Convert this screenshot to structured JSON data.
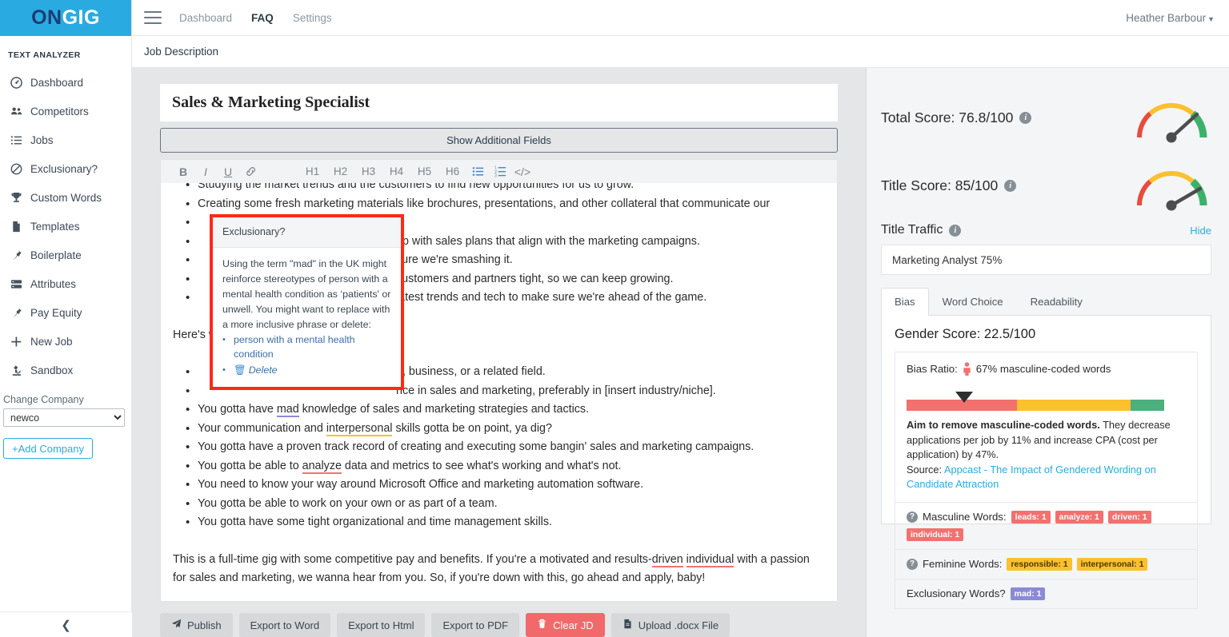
{
  "brand": {
    "logo_on": "ON",
    "logo_gig": "GIG",
    "accent": "#29ABE2"
  },
  "sidebar": {
    "section_title": "TEXT ANALYZER",
    "items": [
      {
        "label": "Dashboard",
        "icon": "dashboard-icon"
      },
      {
        "label": "Competitors",
        "icon": "people-icon"
      },
      {
        "label": "Jobs",
        "icon": "list-icon"
      },
      {
        "label": "Exclusionary?",
        "icon": "ban-icon"
      },
      {
        "label": "Custom Words",
        "icon": "trophy-icon"
      },
      {
        "label": "Templates",
        "icon": "file-icon"
      },
      {
        "label": "Boilerplate",
        "icon": "pin-icon"
      },
      {
        "label": "Attributes",
        "icon": "server-icon"
      },
      {
        "label": "Pay Equity",
        "icon": "pin-icon"
      },
      {
        "label": "New Job",
        "icon": "plus-icon"
      },
      {
        "label": "Sandbox",
        "icon": "microscope-icon"
      }
    ],
    "change_company_label": "Change Company",
    "company_selected": "newco",
    "company_options": [
      "newco"
    ],
    "add_company_label": "+Add Company",
    "collapse_icon": "chevron-left-icon"
  },
  "topnav": {
    "links": [
      {
        "label": "Dashboard",
        "active": false
      },
      {
        "label": "FAQ",
        "active": true
      },
      {
        "label": "Settings",
        "active": false
      }
    ],
    "user": "Heather Barbour"
  },
  "subheader": {
    "breadcrumb": "Job Description"
  },
  "editor": {
    "job_title": "Sales & Marketing Specialist",
    "show_additional_fields": "Show Additional Fields",
    "toolbar": {
      "bold": "B",
      "italic": "I",
      "underline": "U",
      "link": "link-icon",
      "headings": [
        "H1",
        "H2",
        "H3",
        "H4",
        "H5",
        "H6"
      ],
      "bullet_list": "bullet-list-icon",
      "numbered_list": "numbered-list-icon",
      "code": "</>"
    },
    "content": {
      "clipped_top_line": "Studying the market trends and the customers to find new opportunities for us to grow.",
      "bullets_top": [
        "Creating some fresh marketing materials like brochures, presentations, and other collateral that communicate our",
        "up with sales plans that align with the marketing campaigns.",
        "sure we're smashing it.",
        "customers and partners tight, so we can keep growing.",
        "latest trends and tech to make sure we're ahead of the game."
      ],
      "heres_line": "Here's what you gotta have to be eligible:",
      "bullets_hidden_tail": [
        "g, business, or a related field.",
        "nce in sales and marketing, preferably in [insert industry/niche]."
      ],
      "bullets_bottom": [
        {
          "pre": "You gotta have ",
          "mark": "mad",
          "mark_style": "purple",
          "post": " knowledge of sales and marketing strategies and tactics."
        },
        {
          "pre": "Your communication and ",
          "mark": "interpersonal",
          "mark_style": "yellow",
          "post": " skills gotta be on point, ya dig?"
        },
        {
          "pre": "You gotta have a proven track record of creating and executing some bangin' sales and marketing campaigns.",
          "mark": "",
          "mark_style": "",
          "post": ""
        },
        {
          "pre": "You gotta be able to ",
          "mark": "analyze",
          "mark_style": "red",
          "post": " data and metrics to see what's working and what's not."
        },
        {
          "pre": "You need to know your way around Microsoft Office and marketing automation software.",
          "mark": "",
          "mark_style": "",
          "post": ""
        },
        {
          "pre": "You gotta be able to work on your own or as part of a team.",
          "mark": "",
          "mark_style": "",
          "post": ""
        },
        {
          "pre": "You gotta have some tight organizational and time management skills.",
          "mark": "",
          "mark_style": "",
          "post": ""
        }
      ],
      "closing_pre": "This is a full-time gig with some competitive pay and benefits. If you're a motivated and results-",
      "closing_mark1": "driven",
      "closing_mid": " ",
      "closing_mark2": "individual",
      "closing_post": " with a passion for sales and marketing, we wanna hear from you. So, if you're down with this, go ahead and apply, baby!"
    },
    "popup": {
      "title": "Exclusionary?",
      "body": "Using the term \"mad\" in the UK might reinforce stereotypes of person with a mental health condition as ‘patients' or unwell. You might want to replace with a more inclusive phrase or delete:",
      "suggestion": "person with a mental health condition",
      "delete_label": "Delete",
      "border_color": "#fc2a16"
    },
    "buttons": [
      {
        "label": "Publish",
        "icon": "paper-plane-icon",
        "style": "default"
      },
      {
        "label": "Export to Word",
        "icon": "",
        "style": "default"
      },
      {
        "label": "Export to Html",
        "icon": "",
        "style": "default"
      },
      {
        "label": "Export to PDF",
        "icon": "",
        "style": "default"
      },
      {
        "label": "Clear JD",
        "icon": "trash-icon",
        "style": "danger"
      },
      {
        "label": "Upload .docx File",
        "icon": "doc-icon",
        "style": "default"
      }
    ]
  },
  "panel": {
    "total_score_label": "Total Score: 76.8/100",
    "title_score_label": "Title Score: 85/100",
    "title_traffic_label": "Title Traffic",
    "hide_label": "Hide",
    "traffic_value": "Marketing Analyst 75%",
    "tabs": [
      {
        "label": "Bias",
        "active": true
      },
      {
        "label": "Word Choice",
        "active": false
      },
      {
        "label": "Readability",
        "active": false
      }
    ],
    "gender_score": "Gender Score: 22.5/100",
    "bias_ratio_label": "Bias Ratio:",
    "bias_ratio_value": "67% masculine-coded words",
    "bias_advice_bold": "Aim to remove masculine-coded words.",
    "bias_advice_rest": " They decrease applications per job by 11% and increase CPA (cost per application) by 47%.",
    "source_label": "Source:",
    "source_link": "Appcast - The Impact of Gendered Wording on Candidate Attraction",
    "masculine_label": "Masculine Words:",
    "masculine_words": [
      "leads: 1",
      "analyze: 1",
      "driven: 1",
      "individual: 1"
    ],
    "feminine_label": "Feminine Words:",
    "feminine_words": [
      "responsible: 1",
      "interpersonal: 1"
    ],
    "exclusionary_label": "Exclusionary Words?",
    "exclusionary_words": [
      "mad: 1"
    ]
  },
  "chart_data": [
    {
      "type": "gauge",
      "title": "Total Score",
      "value": 76.8,
      "max": 100,
      "zones": [
        {
          "color": "#e74c3c",
          "from": 0,
          "to": 33
        },
        {
          "color": "#fbc02d",
          "from": 33,
          "to": 66
        },
        {
          "color": "#4caf50",
          "from": 66,
          "to": 100
        }
      ]
    },
    {
      "type": "gauge",
      "title": "Title Score",
      "value": 85,
      "max": 100,
      "zones": [
        {
          "color": "#e74c3c",
          "from": 0,
          "to": 33
        },
        {
          "color": "#fbc02d",
          "from": 33,
          "to": 66
        },
        {
          "color": "#4caf50",
          "from": 66,
          "to": 100
        }
      ]
    },
    {
      "type": "bar",
      "title": "Bias Ratio",
      "orientation": "horizontal-stacked",
      "categories": [
        "red",
        "yellow",
        "green"
      ],
      "values": [
        43,
        44,
        13
      ],
      "marker_value": 22.5,
      "colors": [
        "#f2716f",
        "#fbc02d",
        "#4caf7d"
      ],
      "xlabel": "",
      "ylabel": "",
      "xlim": [
        0,
        100
      ]
    }
  ]
}
